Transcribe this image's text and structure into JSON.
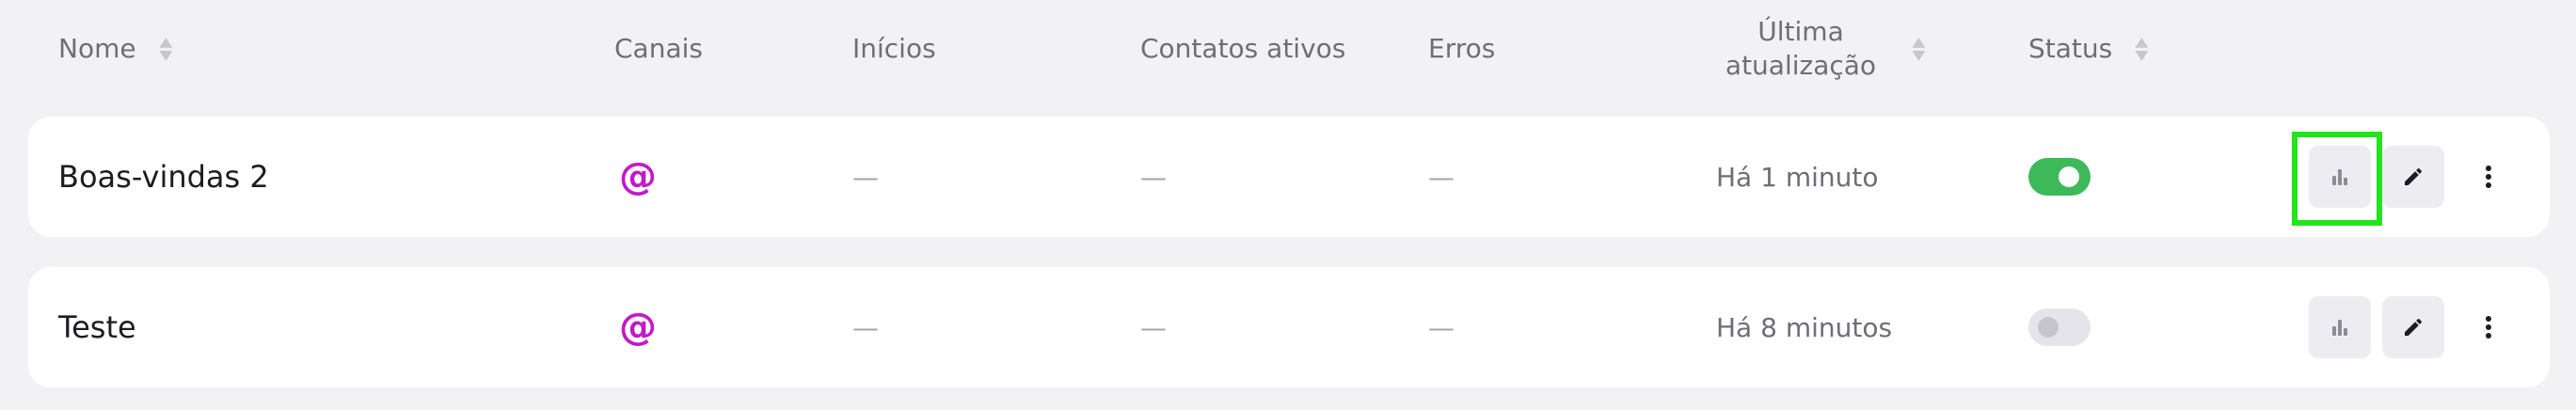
{
  "columns": {
    "name": "Nome",
    "channels": "Canais",
    "starts": "Inícios",
    "active_contacts": "Contatos ativos",
    "errors": "Erros",
    "last_update_line1": "Última",
    "last_update_line2": "atualização",
    "status": "Status"
  },
  "rows": [
    {
      "name": "Boas-vindas 2",
      "channel_icon": "@",
      "starts": "—",
      "active_contacts": "—",
      "errors": "—",
      "updated": "Há 1 minuto",
      "status_on": true
    },
    {
      "name": "Teste",
      "channel_icon": "@",
      "starts": "—",
      "active_contacts": "—",
      "errors": "—",
      "updated": "Há 8 minutos",
      "status_on": false
    }
  ],
  "icons": {
    "stats": "bar-chart-icon",
    "edit": "pencil-icon",
    "more": "more-vertical-icon"
  },
  "colors": {
    "channel": "#c21ac9",
    "toggle_on": "#3db95a",
    "highlight": "#22e51b"
  }
}
